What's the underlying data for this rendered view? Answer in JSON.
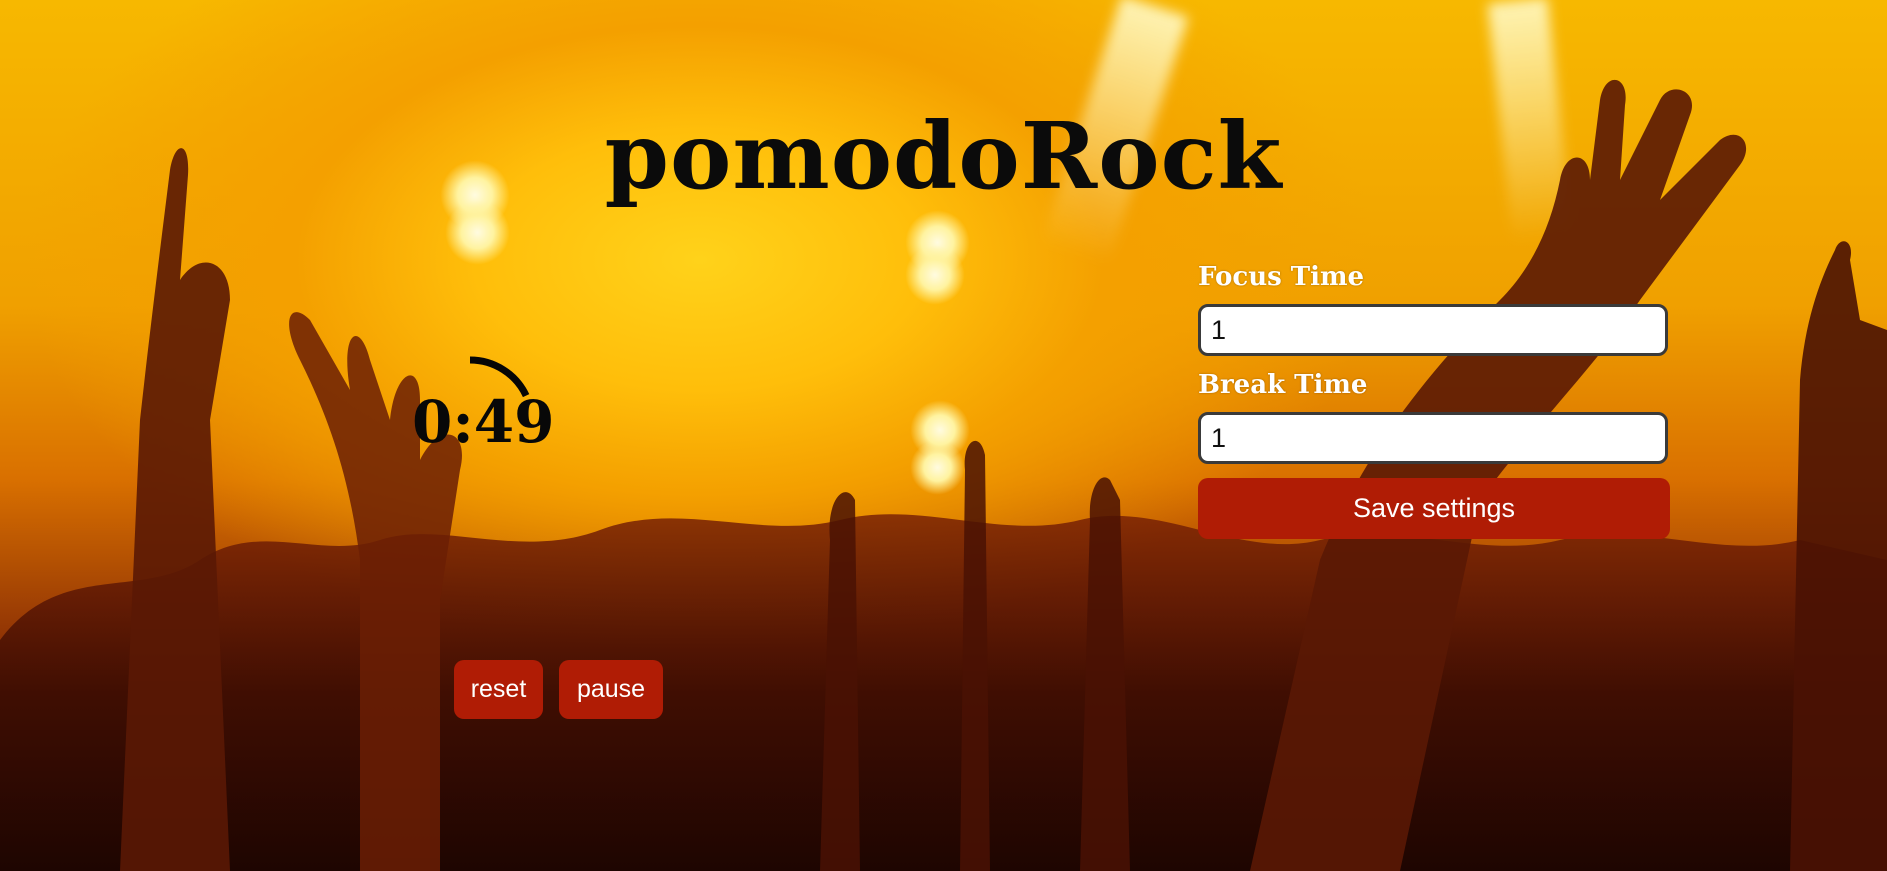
{
  "app": {
    "title": "pomodoRock"
  },
  "timer": {
    "display": "0:49",
    "progress_fraction": 0.82
  },
  "controls": {
    "reset_label": "reset",
    "pause_label": "pause"
  },
  "settings": {
    "focus_label": "Focus Time",
    "focus_value": "1",
    "break_label": "Break Time",
    "break_value": "1",
    "save_label": "Save settings"
  },
  "colors": {
    "button_bg": "#b01c05",
    "button_text": "#ffffff",
    "title_text": "#0b0b0b",
    "label_text": "#ffffff"
  }
}
